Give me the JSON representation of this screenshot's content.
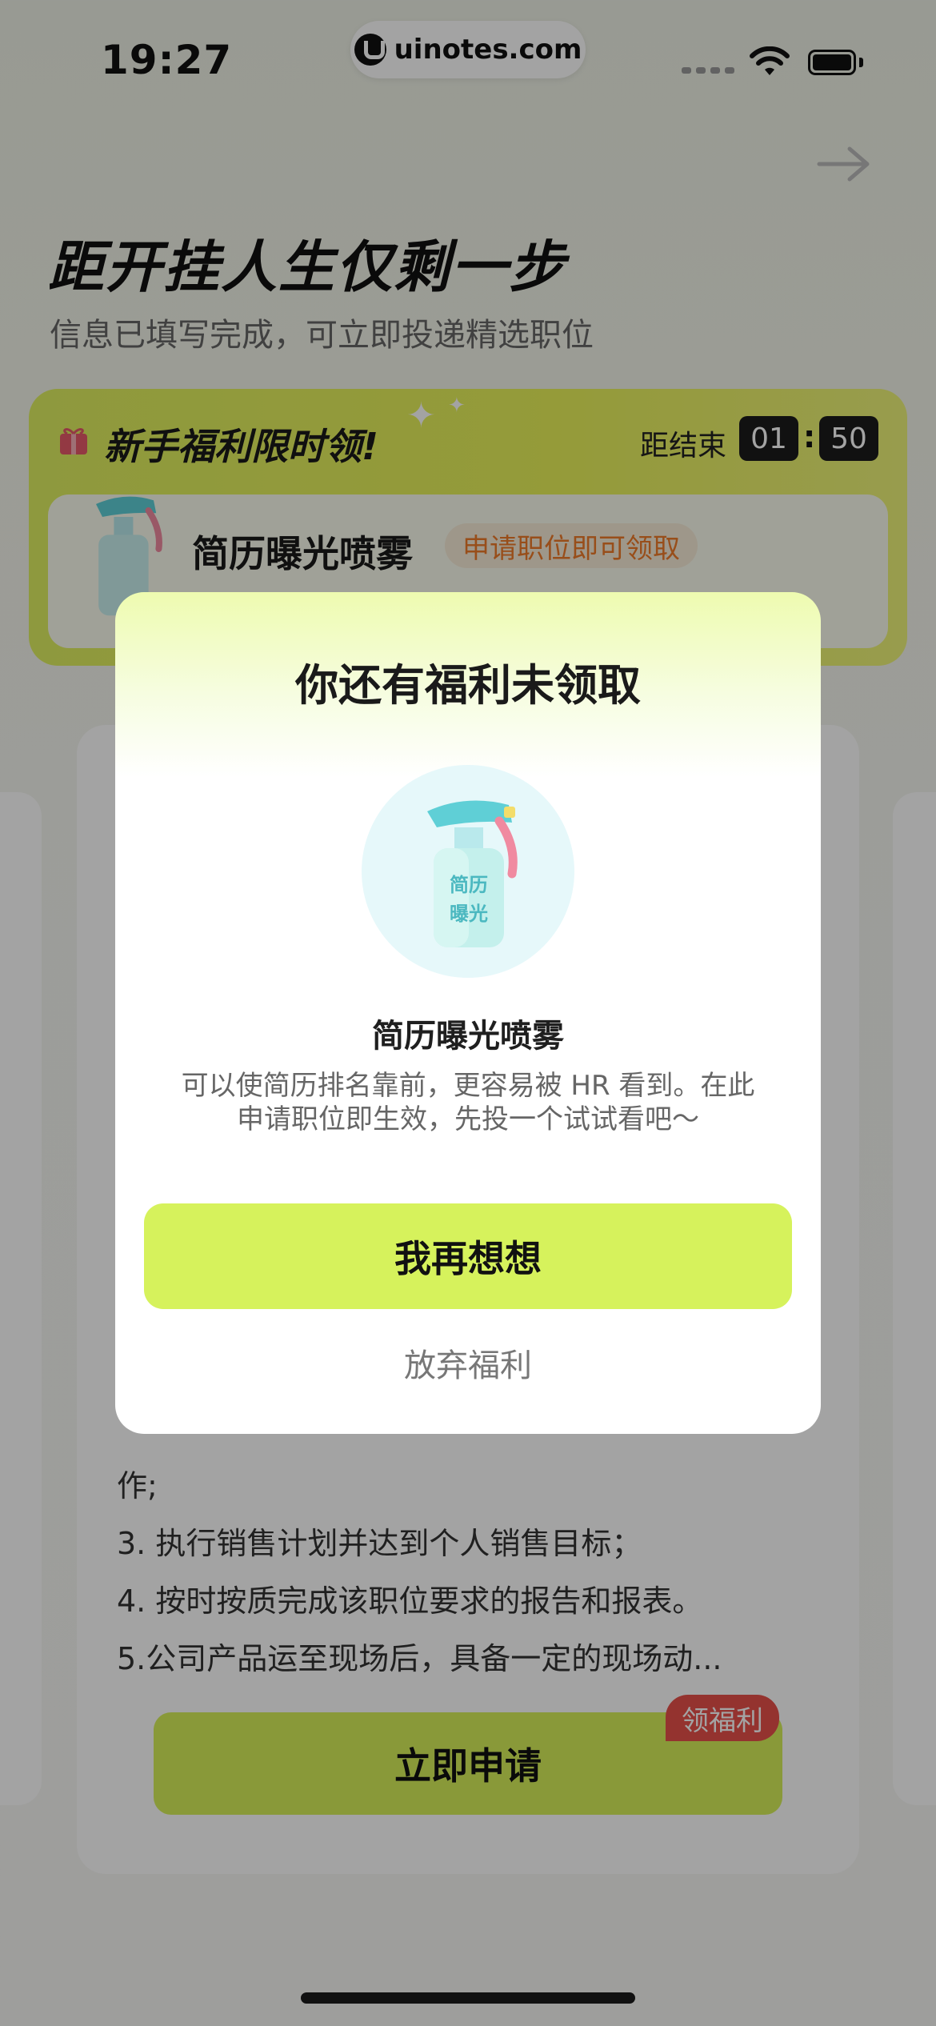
{
  "status_bar": {
    "time": "19:27",
    "url": "uinotes.com"
  },
  "page": {
    "headline": "距开挂人生仅剩一步",
    "subhead": "信息已填写完成，可立即投递精选职位"
  },
  "welfare_card": {
    "title": "新手福利限时领!",
    "countdown_label": "距结束",
    "countdown_min": "01",
    "countdown_sec": "50",
    "countdown_sep": ":",
    "item_title": "简历曝光喷雾",
    "item_tag": "申请职位即可领取"
  },
  "job_card": {
    "desc_lines": [
      "作;",
      "3. 执行销售计划并达到个人销售目标；",
      "4. 按时按质完成该职位要求的报告和报表。",
      "5.公司产品运至现场后，具备一定的现场动..."
    ],
    "apply_label": "立即申请",
    "apply_badge": "领福利"
  },
  "modal": {
    "title": "你还有福利未领取",
    "icon_label_line1": "简历",
    "icon_label_line2": "曝光",
    "item_name": "简历曝光喷雾",
    "description": "可以使简历排名靠前，更容易被 HR 看到。在此申请职位即生效，先投一个试试看吧～",
    "primary_button": "我再想想",
    "secondary_link": "放弃福利"
  },
  "icons": {
    "back": "arrow-right-icon",
    "gift": "gift-icon",
    "spray": "spray-bottle-icon"
  },
  "colors": {
    "accent_lime": "#d6f25c",
    "tag_orange": "#ee7a2a",
    "badge_red": "#e8504a"
  }
}
